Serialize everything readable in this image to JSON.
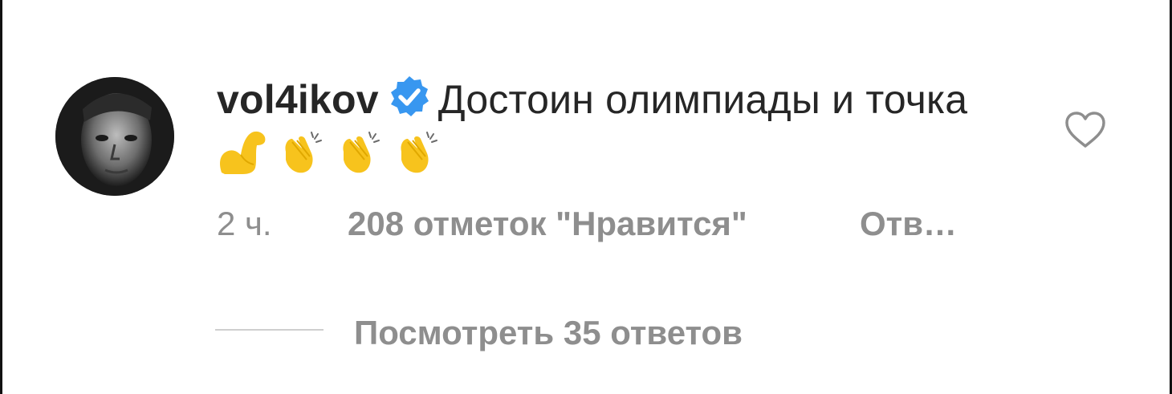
{
  "comment": {
    "username": "vol4ikov",
    "verified": true,
    "text": "Достоин олимпиады и точка",
    "emojis": [
      "flexed-biceps",
      "clapping-hands",
      "clapping-hands",
      "clapping-hands"
    ]
  },
  "meta": {
    "time": "2 ч.",
    "likes": "208 отметок \"Нравится\"",
    "reply": "Отв…"
  },
  "replies": {
    "view_label": "Посмотреть 35 ответов"
  },
  "icons": {
    "verified": "verified-badge-icon",
    "like": "heart-outline-icon"
  },
  "colors": {
    "verified_blue": "#3897f0",
    "text": "#262626",
    "secondary": "#8e8e8e",
    "emoji_yellow": "#f7c31d"
  }
}
